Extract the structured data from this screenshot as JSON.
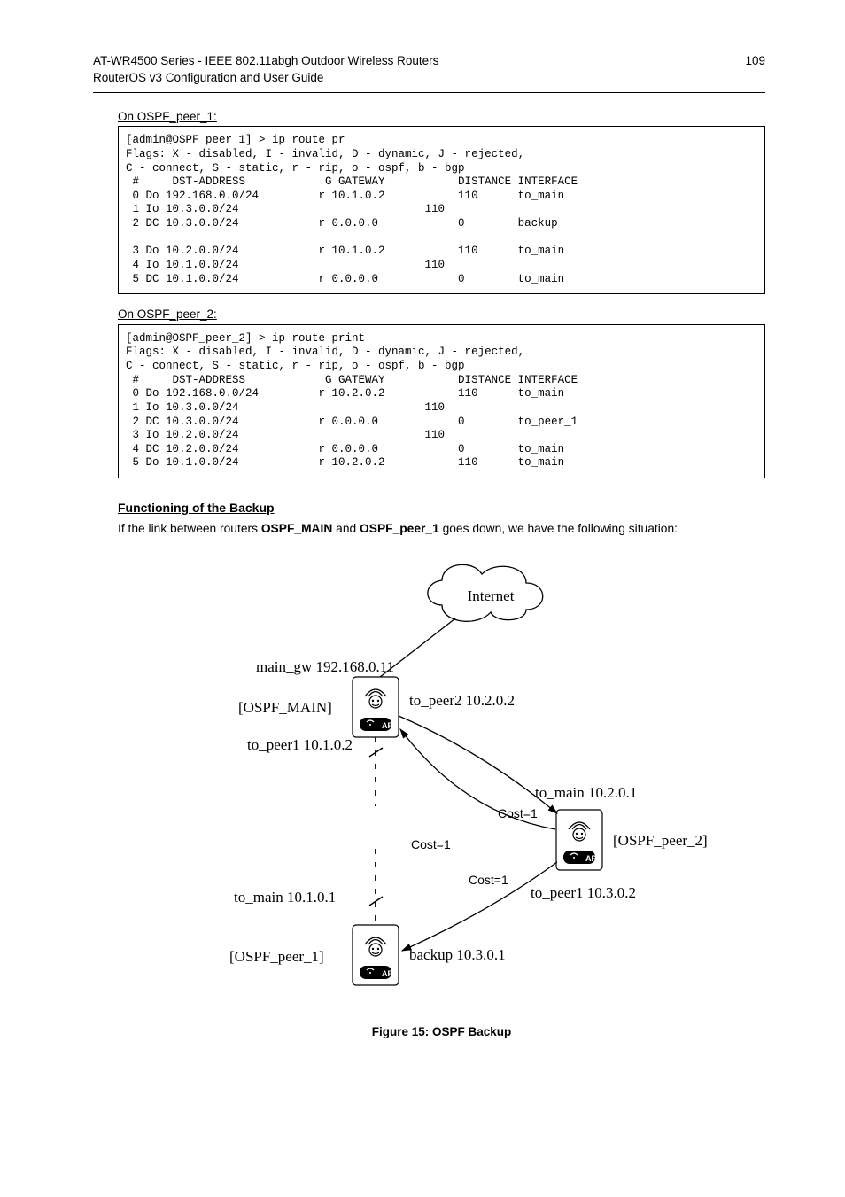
{
  "header": {
    "title_line1": "AT-WR4500 Series - IEEE 802.11abgh Outdoor Wireless Routers",
    "title_line2": "RouterOS v3 Configuration and User Guide",
    "page_number": "109"
  },
  "block1": {
    "label": "On OSPF_peer_1:",
    "code": "[admin@OSPF_peer_1] > ip route pr\nFlags: X - disabled, I - invalid, D - dynamic, J - rejected,\nC - connect, S - static, r - rip, o - ospf, b - bgp\n #     DST-ADDRESS            G GATEWAY           DISTANCE INTERFACE\n 0 Do 192.168.0.0/24         r 10.1.0.2           110      to_main\n 1 Io 10.3.0.0/24                            110\n 2 DC 10.3.0.0/24            r 0.0.0.0            0        backup\n\n 3 Do 10.2.0.0/24            r 10.1.0.2           110      to_main\n 4 Io 10.1.0.0/24                            110\n 5 DC 10.1.0.0/24            r 0.0.0.0            0        to_main"
  },
  "block2": {
    "label": "On OSPF_peer_2:",
    "code": "[admin@OSPF_peer_2] > ip route print\nFlags: X - disabled, I - invalid, D - dynamic, J - rejected,\nC - connect, S - static, r - rip, o - ospf, b - bgp\n #     DST-ADDRESS            G GATEWAY           DISTANCE INTERFACE\n 0 Do 192.168.0.0/24         r 10.2.0.2           110      to_main\n 1 Io 10.3.0.0/24                            110\n 2 DC 10.3.0.0/24            r 0.0.0.0            0        to_peer_1\n 3 Io 10.2.0.0/24                            110\n 4 DC 10.2.0.0/24            r 0.0.0.0            0        to_main\n 5 Do 10.1.0.0/24            r 10.2.0.2           110      to_main"
  },
  "section": {
    "heading": "Functioning of the Backup",
    "body": "If the link between routers OSPF_MAIN and OSPF_peer_1 goes down, we have the following situation:"
  },
  "diagram": {
    "internet": "Internet",
    "main_gw": "main_gw 192.168.0.11",
    "ospf_main": "[OSPF_MAIN]",
    "ospf_peer1": "[OSPF_peer_1]",
    "ospf_peer2": "[OSPF_peer_2]",
    "to_peer2": "to_peer2 10.2.0.2",
    "to_peer1_a": "to_peer1 10.1.0.2",
    "to_main_a": "to_main 10.1.0.1",
    "to_main_b": "to_main 10.2.0.1",
    "to_peer1_b": "to_peer1 10.3.0.2",
    "backup": "backup 10.3.0.1",
    "cost": "Cost=1",
    "ap": "AP"
  },
  "figure_caption": "Figure 15: OSPF Backup"
}
